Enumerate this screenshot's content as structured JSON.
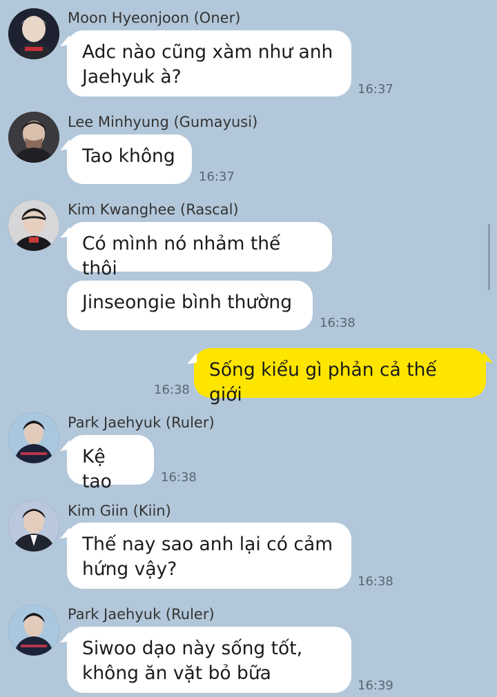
{
  "messages": [
    {
      "sender": "Moon Hyeonjoon (Oner)",
      "text": "Adc nào cũng xàm như anh\nJaehyuk à?",
      "time": "16:37",
      "avatar_icon": "profile-photo-oner"
    },
    {
      "sender": "Lee Minhyung (Gumayusi)",
      "text": "Tao không",
      "time": "16:37",
      "avatar_icon": "profile-photo-gumayusi"
    },
    {
      "sender": "Kim Kwanghee (Rascal)",
      "text": "Có mình nó nhảm thế thôi",
      "text2": "Jinseongie bình thường",
      "time": "16:38",
      "avatar_icon": "profile-photo-rascal"
    },
    {
      "sender": "me",
      "text": "Sống kiểu gì phản cả thế giới",
      "time": "16:38"
    },
    {
      "sender": "Park Jaehyuk (Ruler)",
      "text": "Kệ tao",
      "time": "16:38",
      "avatar_icon": "profile-photo-ruler"
    },
    {
      "sender": "Kim Giin (Kiin)",
      "text": "Thế nay sao anh lại có cảm\nhứng vậy?",
      "time": "16:38",
      "avatar_icon": "profile-photo-kiin"
    },
    {
      "sender": "Park Jaehyuk (Ruler)",
      "text": "Siwoo dạo này sống tốt,\nkhông ăn vặt bỏ bữa",
      "time": "16:39",
      "avatar_icon": "profile-photo-ruler"
    }
  ],
  "colors": {
    "background": "#b2c7d9",
    "incoming_bubble": "#ffffff",
    "outgoing_bubble": "#fee500"
  }
}
